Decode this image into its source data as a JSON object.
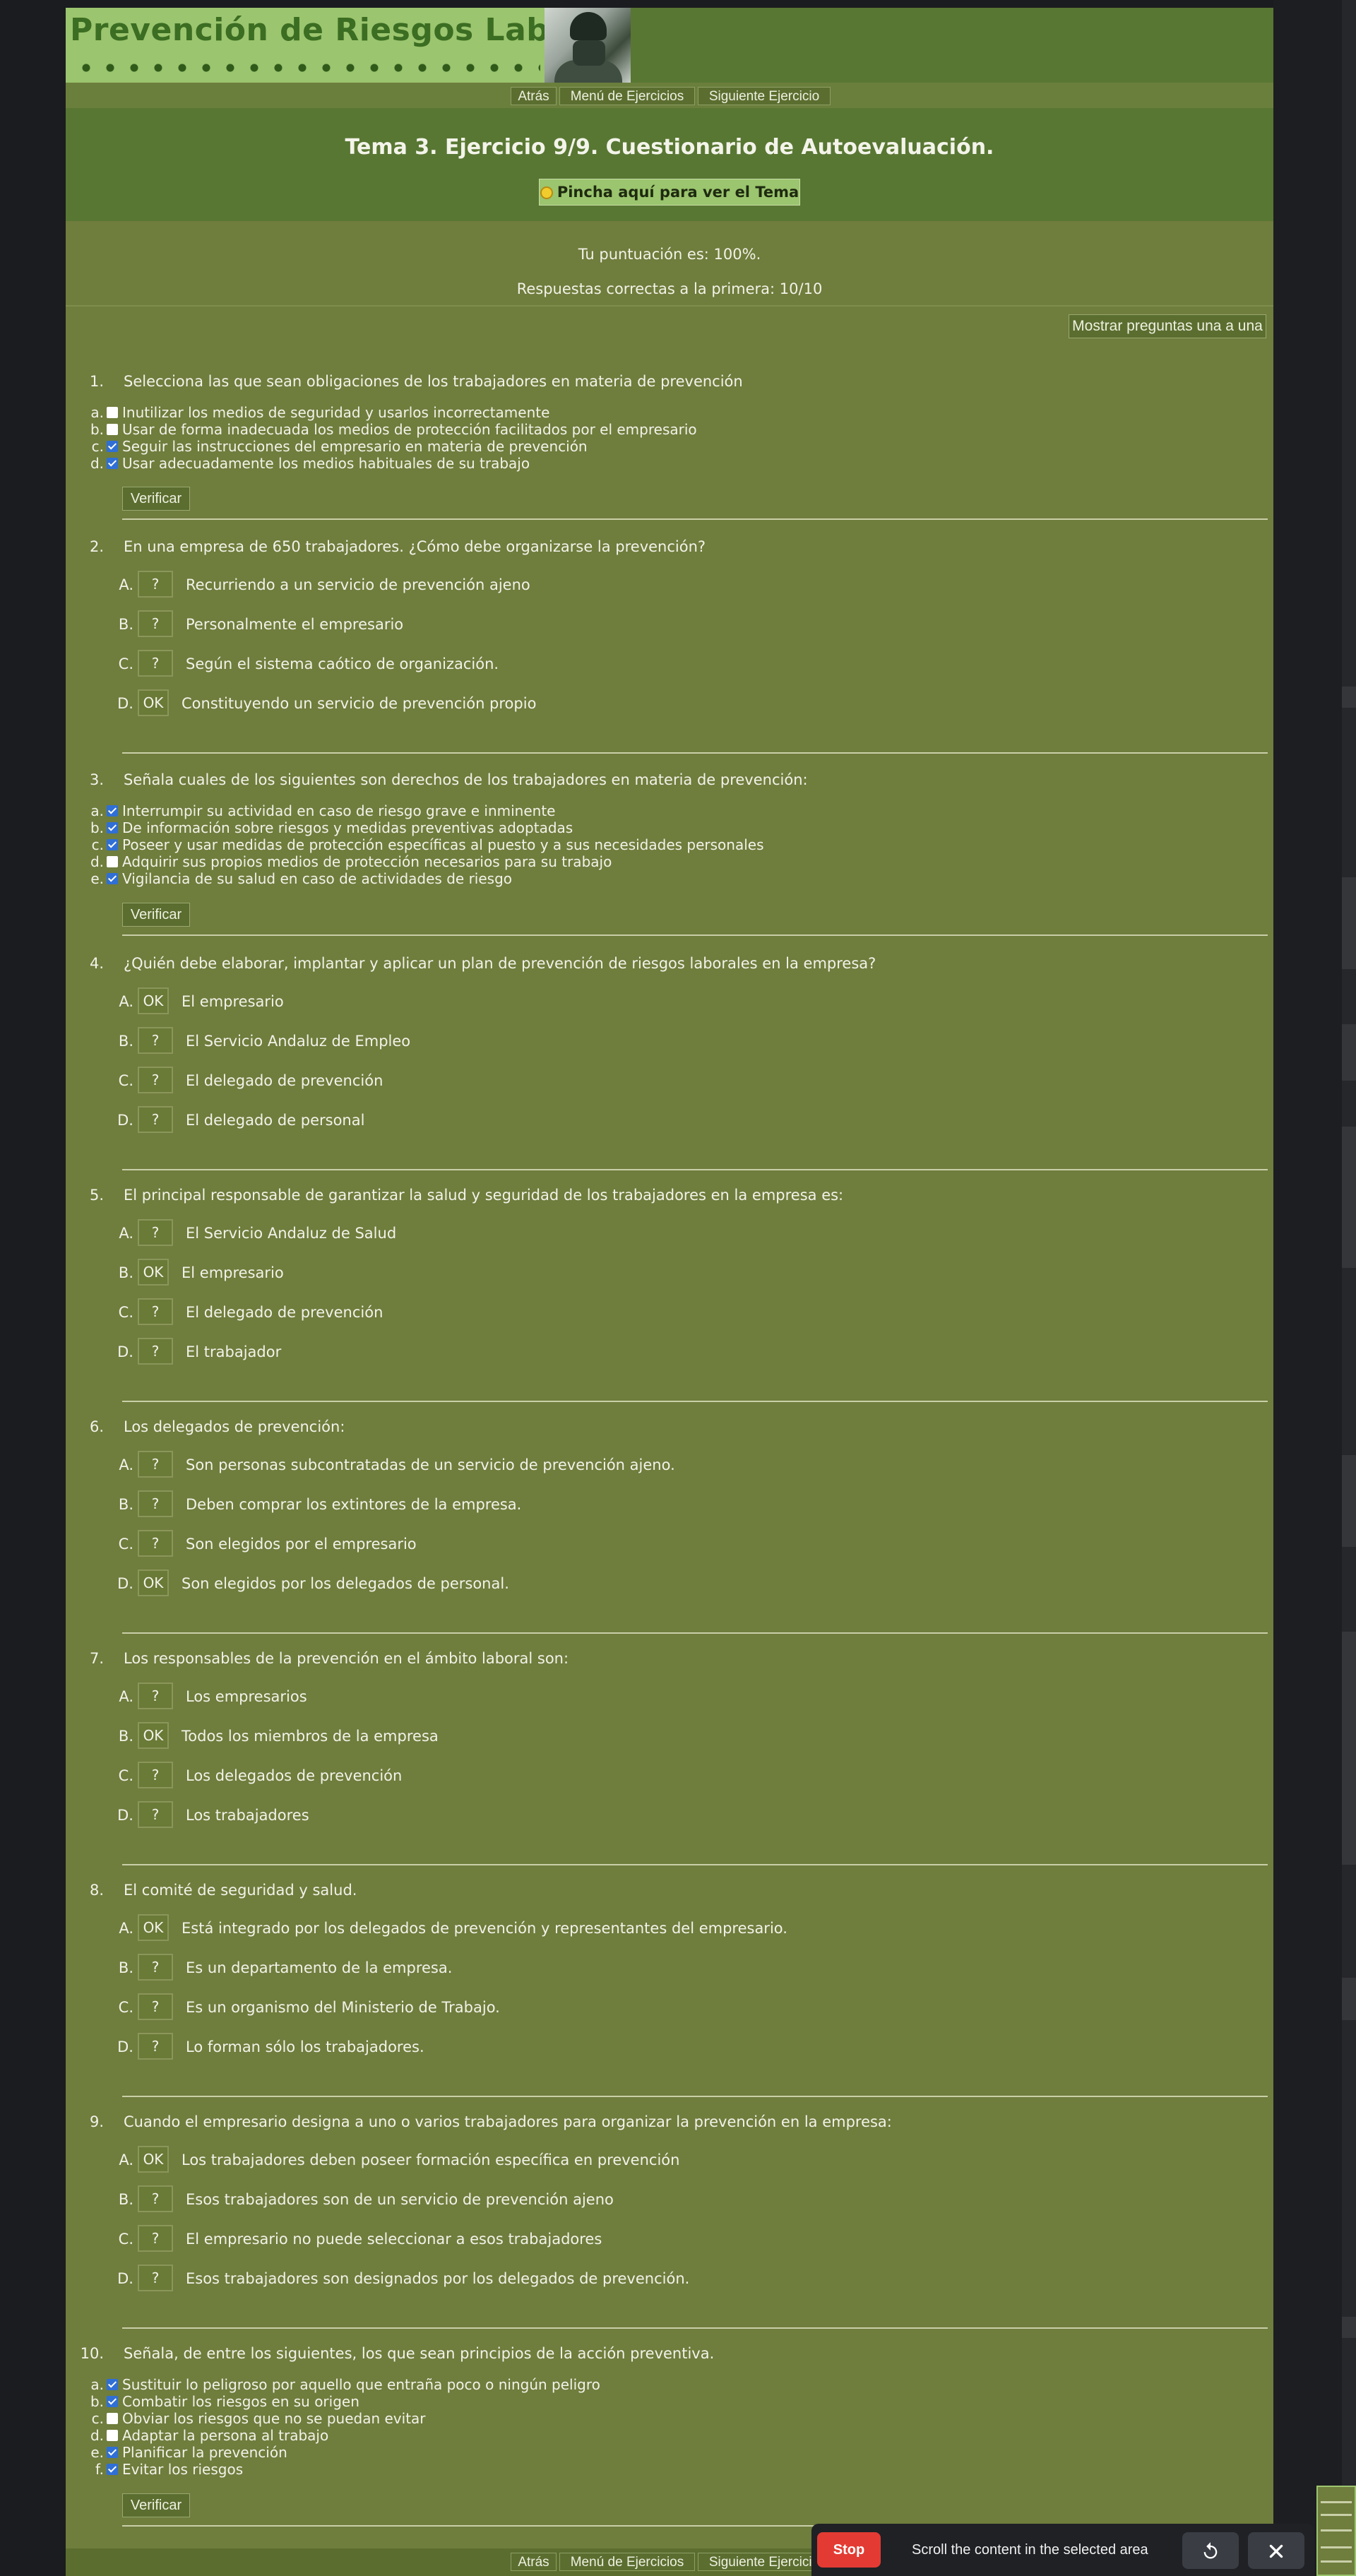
{
  "header": {
    "logo_text": "Prevención de Riesgos Laborales",
    "nav": {
      "back": "Atrás",
      "menu": "Menú de Ejercicios",
      "next": "Siguiente Ejercicio"
    },
    "title": "Tema 3. Ejercicio 9/9. Cuestionario de Autoevaluación.",
    "tema_button": "Pincha aquí para ver el Tema"
  },
  "score": {
    "text": "Tu puntuación es: 100%.",
    "first_try": "Respuestas correctas a la primera: 10/10"
  },
  "mostrar_button": "Mostrar preguntas una a una",
  "verificar_label": "Verificar",
  "questions": [
    {
      "num": "1.",
      "text": "Selecciona las que sean obligaciones de los trabajadores en materia de prevención",
      "options": [
        {
          "letter": "a.",
          "text": "Inutilizar los medios de seguridad y usarlos incorrectamente",
          "checked": false
        },
        {
          "letter": "b.",
          "text": "Usar de forma inadecuada los medios de protección facilitados por el empresario",
          "checked": false
        },
        {
          "letter": "c.",
          "text": "Seguir las instrucciones del empresario en materia de prevención",
          "checked": true
        },
        {
          "letter": "d.",
          "text": "Usar adecuadamente los medios habituales de su trabajo",
          "checked": true
        }
      ]
    },
    {
      "num": "2.",
      "text": "En una empresa de 650 trabajadores. ¿Cómo debe organizarse la prevención?",
      "options": [
        {
          "letter": "A.",
          "mark": "?",
          "text": "Recurriendo a un servicio de prevención ajeno"
        },
        {
          "letter": "B.",
          "mark": "?",
          "text": "Personalmente el empresario"
        },
        {
          "letter": "C.",
          "mark": "?",
          "text": "Según el sistema caótico de organización."
        },
        {
          "letter": "D.",
          "mark": "OK",
          "text": "Constituyendo un servicio de prevención propio"
        }
      ]
    },
    {
      "num": "3.",
      "text": "Señala cuales de los siguientes son derechos de los trabajadores en materia de prevención:",
      "options": [
        {
          "letter": "a.",
          "text": "Interrumpir su actividad en caso de riesgo grave e inminente",
          "checked": true
        },
        {
          "letter": "b.",
          "text": "De información sobre riesgos y medidas preventivas adoptadas",
          "checked": true
        },
        {
          "letter": "c.",
          "text": "Poseer y usar medidas de protección específicas al puesto y a sus necesidades personales",
          "checked": true
        },
        {
          "letter": "d.",
          "text": "Adquirir sus propios medios de protección necesarios para su trabajo",
          "checked": false
        },
        {
          "letter": "e.",
          "text": "Vigilancia de su salud en caso de actividades de riesgo",
          "checked": true
        }
      ]
    },
    {
      "num": "4.",
      "text": "¿Quién debe elaborar, implantar y aplicar un plan de prevención de riesgos laborales en la empresa?",
      "options": [
        {
          "letter": "A.",
          "mark": "OK",
          "text": "El empresario"
        },
        {
          "letter": "B.",
          "mark": "?",
          "text": "El Servicio Andaluz de Empleo"
        },
        {
          "letter": "C.",
          "mark": "?",
          "text": "El delegado de prevención"
        },
        {
          "letter": "D.",
          "mark": "?",
          "text": "El delegado de personal"
        }
      ]
    },
    {
      "num": "5.",
      "text": "El principal responsable de garantizar la salud y seguridad de los trabajadores en la empresa es:",
      "options": [
        {
          "letter": "A.",
          "mark": "?",
          "text": "El Servicio Andaluz de Salud"
        },
        {
          "letter": "B.",
          "mark": "OK",
          "text": "El empresario"
        },
        {
          "letter": "C.",
          "mark": "?",
          "text": "El delegado de prevención"
        },
        {
          "letter": "D.",
          "mark": "?",
          "text": "El trabajador"
        }
      ]
    },
    {
      "num": "6.",
      "text": "Los delegados de prevención:",
      "options": [
        {
          "letter": "A.",
          "mark": "?",
          "text": "Son personas subcontratadas de un servicio de prevención ajeno."
        },
        {
          "letter": "B.",
          "mark": "?",
          "text": "Deben comprar los extintores de la empresa."
        },
        {
          "letter": "C.",
          "mark": "?",
          "text": "Son elegidos por el empresario"
        },
        {
          "letter": "D.",
          "mark": "OK",
          "text": "Son elegidos por los delegados de personal."
        }
      ]
    },
    {
      "num": "7.",
      "text": "Los responsables de la prevención en el ámbito laboral son:",
      "options": [
        {
          "letter": "A.",
          "mark": "?",
          "text": "Los empresarios"
        },
        {
          "letter": "B.",
          "mark": "OK",
          "text": "Todos los miembros de la empresa"
        },
        {
          "letter": "C.",
          "mark": "?",
          "text": "Los delegados de prevención"
        },
        {
          "letter": "D.",
          "mark": "?",
          "text": "Los trabajadores"
        }
      ]
    },
    {
      "num": "8.",
      "text": "El comité de seguridad y salud.",
      "options": [
        {
          "letter": "A.",
          "mark": "OK",
          "text": "Está integrado por los delegados de prevención y representantes del empresario."
        },
        {
          "letter": "B.",
          "mark": "?",
          "text": "Es un departamento de la empresa."
        },
        {
          "letter": "C.",
          "mark": "?",
          "text": "Es un organismo del Ministerio de Trabajo."
        },
        {
          "letter": "D.",
          "mark": "?",
          "text": "Lo forman sólo los trabajadores."
        }
      ]
    },
    {
      "num": "9.",
      "text": "Cuando el empresario designa a uno o varios trabajadores para organizar la prevención en la empresa:",
      "options": [
        {
          "letter": "A.",
          "mark": "OK",
          "text": "Los trabajadores deben poseer formación específica en prevención"
        },
        {
          "letter": "B.",
          "mark": "?",
          "text": "Esos trabajadores son de un servicio de prevención ajeno"
        },
        {
          "letter": "C.",
          "mark": "?",
          "text": "El empresario no puede seleccionar a esos trabajadores"
        },
        {
          "letter": "D.",
          "mark": "?",
          "text": "Esos trabajadores son designados por los delegados de prevención."
        }
      ]
    },
    {
      "num": "10.",
      "text": "Señala, de entre los siguientes, los que sean principios de la acción preventiva.",
      "options": [
        {
          "letter": "a.",
          "text": "Sustituir lo peligroso por aquello que entraña poco o ningún peligro",
          "checked": true
        },
        {
          "letter": "b.",
          "text": "Combatir los riesgos en su origen",
          "checked": true
        },
        {
          "letter": "c.",
          "text": "Obviar los riesgos que no se puedan evitar",
          "checked": false
        },
        {
          "letter": "d.",
          "text": "Adaptar la persona al trabajo",
          "checked": false
        },
        {
          "letter": "e.",
          "text": "Planificar la prevención",
          "checked": true
        },
        {
          "letter": "f.",
          "text": "Evitar los riesgos",
          "checked": true
        }
      ]
    }
  ],
  "bottom_nav": {
    "back": "Atrás",
    "menu": "Menú de Ejercicios",
    "next": "Siguiente Ejercicio"
  },
  "toolbar": {
    "stop": "Stop",
    "message": "Scroll the content in the selected area",
    "reset_icon": "reset-icon",
    "close_icon": "close-icon"
  },
  "colors": {
    "page_bg": "#6f7d3d",
    "header_bg": "#587733",
    "logo_bg": "#9bc56e",
    "checkbox_on": "#2f6fd6",
    "stop_button": "#e33b33"
  }
}
